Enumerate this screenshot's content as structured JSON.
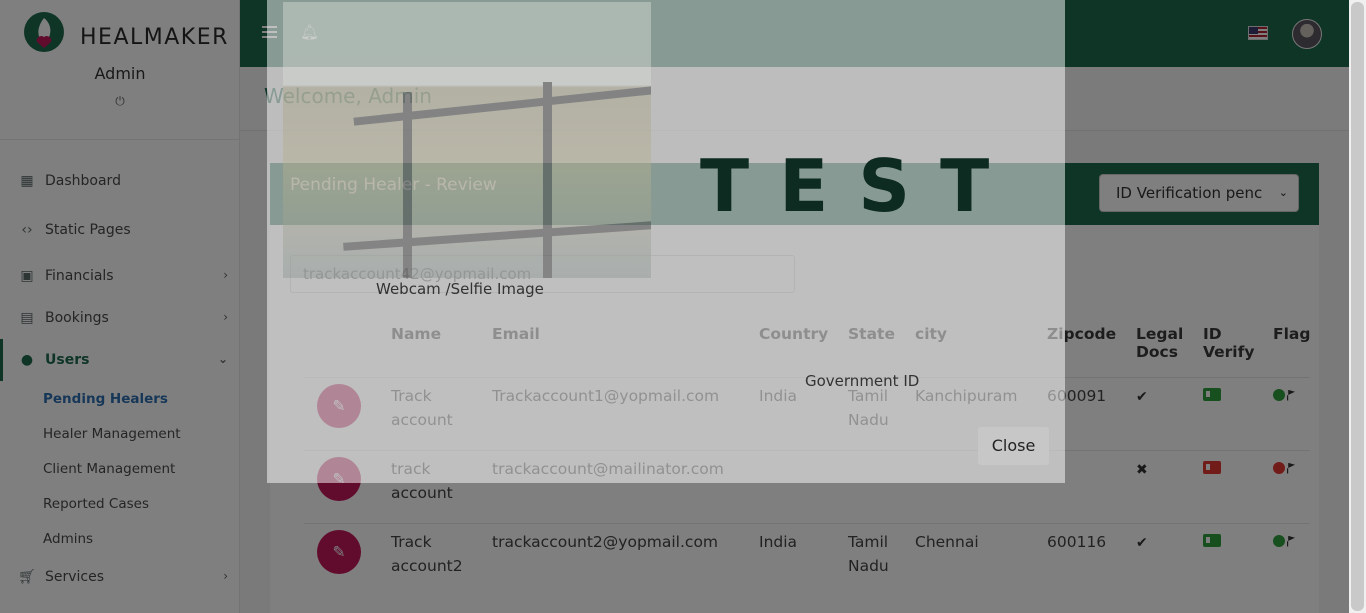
{
  "sidebar": {
    "brand": "HEALMAKER",
    "admin_name": "Admin",
    "items": [
      {
        "label": "Dashboard"
      },
      {
        "label": "Static Pages"
      },
      {
        "label": "Financials"
      },
      {
        "label": "Bookings"
      },
      {
        "label": "Users"
      },
      {
        "label": "Services"
      }
    ],
    "users_sub": [
      {
        "label": "Pending Healers"
      },
      {
        "label": "Healer Management"
      },
      {
        "label": "Client Management"
      },
      {
        "label": "Reported Cases"
      },
      {
        "label": "Admins"
      }
    ]
  },
  "header": {
    "welcome": "Welcome, Admin"
  },
  "card": {
    "title": "Pending Healer - Review",
    "status_select": "ID Verification penc",
    "search_value": "trackaccount42@yopmail.com"
  },
  "table": {
    "headers": [
      "Name",
      "Email",
      "Country",
      "State",
      "city",
      "Zipcode",
      "Legal Docs",
      "ID Verify",
      "Flag"
    ],
    "rows": [
      {
        "name": "Track account",
        "email": "Trackaccount1@yopmail.com",
        "country": "India",
        "state": "Tamil Nadu",
        "city": "Kanchipuram",
        "zip": "600091",
        "legal": "ok",
        "id": "ok",
        "flag": "ok"
      },
      {
        "name": "track account",
        "email": "trackaccount@mailinator.com",
        "country": "",
        "state": "",
        "city": "",
        "zip": "",
        "legal": "bad",
        "id": "bad",
        "flag": "bad"
      },
      {
        "name": "Track account2",
        "email": "trackaccount2@yopmail.com",
        "country": "India",
        "state": "Tamil Nadu",
        "city": "Chennai",
        "zip": "600116",
        "legal": "ok",
        "id": "ok",
        "flag": "ok"
      }
    ]
  },
  "modal": {
    "webcam_caption": "Webcam /Selfie Image",
    "gov_caption": "Government ID",
    "gov_image_text": "TEST",
    "close_label": "Close"
  },
  "colors": {
    "primary": "#1f6b4f",
    "accent": "#c2185b",
    "link": "#2f6fb0"
  }
}
